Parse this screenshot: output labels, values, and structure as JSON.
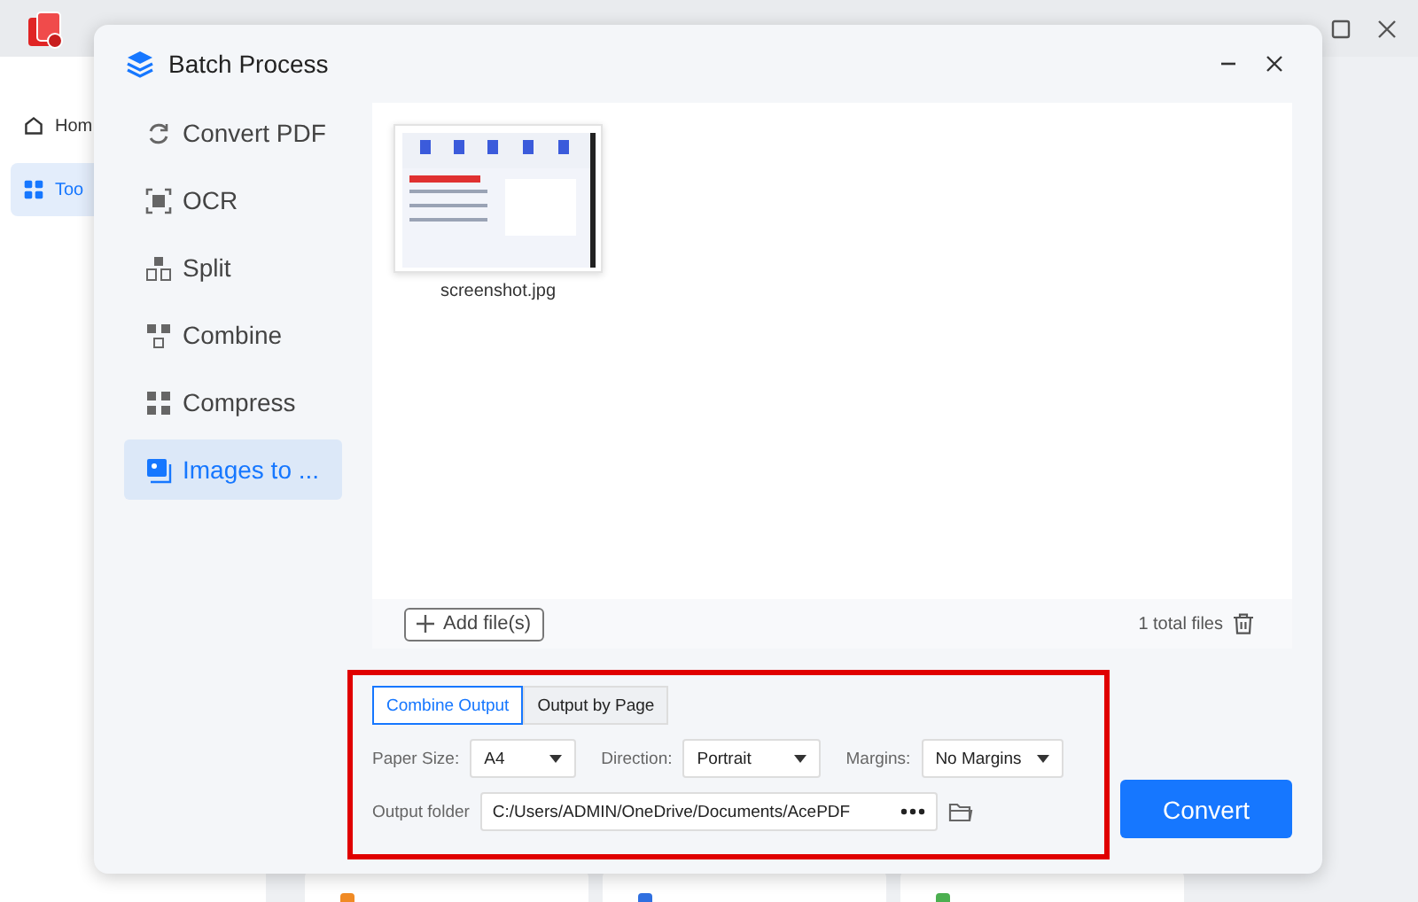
{
  "app": {
    "sidebar": [
      {
        "label": "Hom",
        "selected": false
      },
      {
        "label": "Too",
        "selected": true
      }
    ]
  },
  "dialog": {
    "title": "Batch Process",
    "nav": [
      {
        "label": "Convert PDF",
        "selected": false
      },
      {
        "label": "OCR",
        "selected": false
      },
      {
        "label": "Split",
        "selected": false
      },
      {
        "label": "Combine",
        "selected": false
      },
      {
        "label": "Compress",
        "selected": false
      },
      {
        "label": "Images to ...",
        "selected": true
      }
    ],
    "files": [
      {
        "name": "screenshot.jpg"
      }
    ],
    "add_button": "Add file(s)",
    "total": "1 total files",
    "output_tabs": [
      {
        "label": "Combine Output",
        "selected": true
      },
      {
        "label": "Output by Page",
        "selected": false
      }
    ],
    "settings": [
      {
        "label": "Paper Size:",
        "value": "A4"
      },
      {
        "label": "Direction:",
        "value": "Portrait"
      },
      {
        "label": "Margins:",
        "value": "No Margins"
      }
    ],
    "output_folder": {
      "label": "Output folder",
      "value": "C:/Users/ADMIN/OneDrive/Documents/AcePDF"
    },
    "convert_button": "Convert"
  }
}
